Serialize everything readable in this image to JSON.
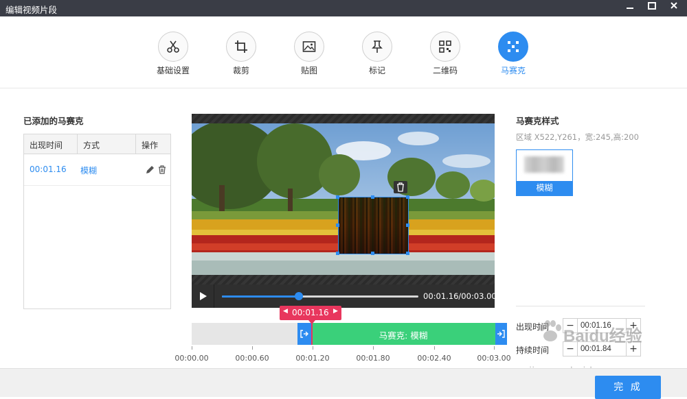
{
  "window": {
    "title": "编辑视频片段",
    "minimize_icon": "minimize-icon",
    "maximize_icon": "maximize-icon",
    "close_icon": "close-icon"
  },
  "toolbar": {
    "tools": [
      {
        "label": "基础设置",
        "icon": "scissors-icon"
      },
      {
        "label": "裁剪",
        "icon": "crop-icon"
      },
      {
        "label": "贴图",
        "icon": "image-icon"
      },
      {
        "label": "标记",
        "icon": "pin-icon"
      },
      {
        "label": "二维码",
        "icon": "qrcode-icon"
      },
      {
        "label": "马赛克",
        "icon": "mosaic-icon",
        "active": true
      }
    ]
  },
  "left_panel": {
    "title": "已添加的马赛克",
    "columns": [
      "出现时间",
      "方式",
      "操作"
    ],
    "rows": [
      {
        "time": "00:01.16",
        "mode": "模糊",
        "actions": [
          "edit-icon",
          "delete-icon"
        ]
      }
    ]
  },
  "player": {
    "time_display": "00:01.16/00:03.00",
    "progress": 0.39,
    "play_icon": "play-icon"
  },
  "timeline": {
    "current_time": "00:01.16",
    "segment_label": "马赛克: 模糊",
    "ticks": [
      "00:00.00",
      "00:00.60",
      "00:01.20",
      "00:01.80",
      "00:02.40",
      "00:03.00"
    ]
  },
  "right_panel": {
    "title": "马赛克样式",
    "region_text": "区域 X522,Y261，宽:245,高:200",
    "style_card_label": "模糊",
    "appear_label": "出现时间",
    "appear_value": "00:01.16",
    "duration_label": "持续时间",
    "duration_value": "00:01.84",
    "minus": "−",
    "plus": "+"
  },
  "footer": {
    "done_label": "完 成"
  },
  "watermark": {
    "text": "Baidu经验",
    "url_text": "jingyan.baidu.com"
  },
  "colors": {
    "accent": "#2d8cf0",
    "timeline_segment": "#3ad07a",
    "playhead": "#e8365d",
    "titlebar": "#3a3d46"
  }
}
